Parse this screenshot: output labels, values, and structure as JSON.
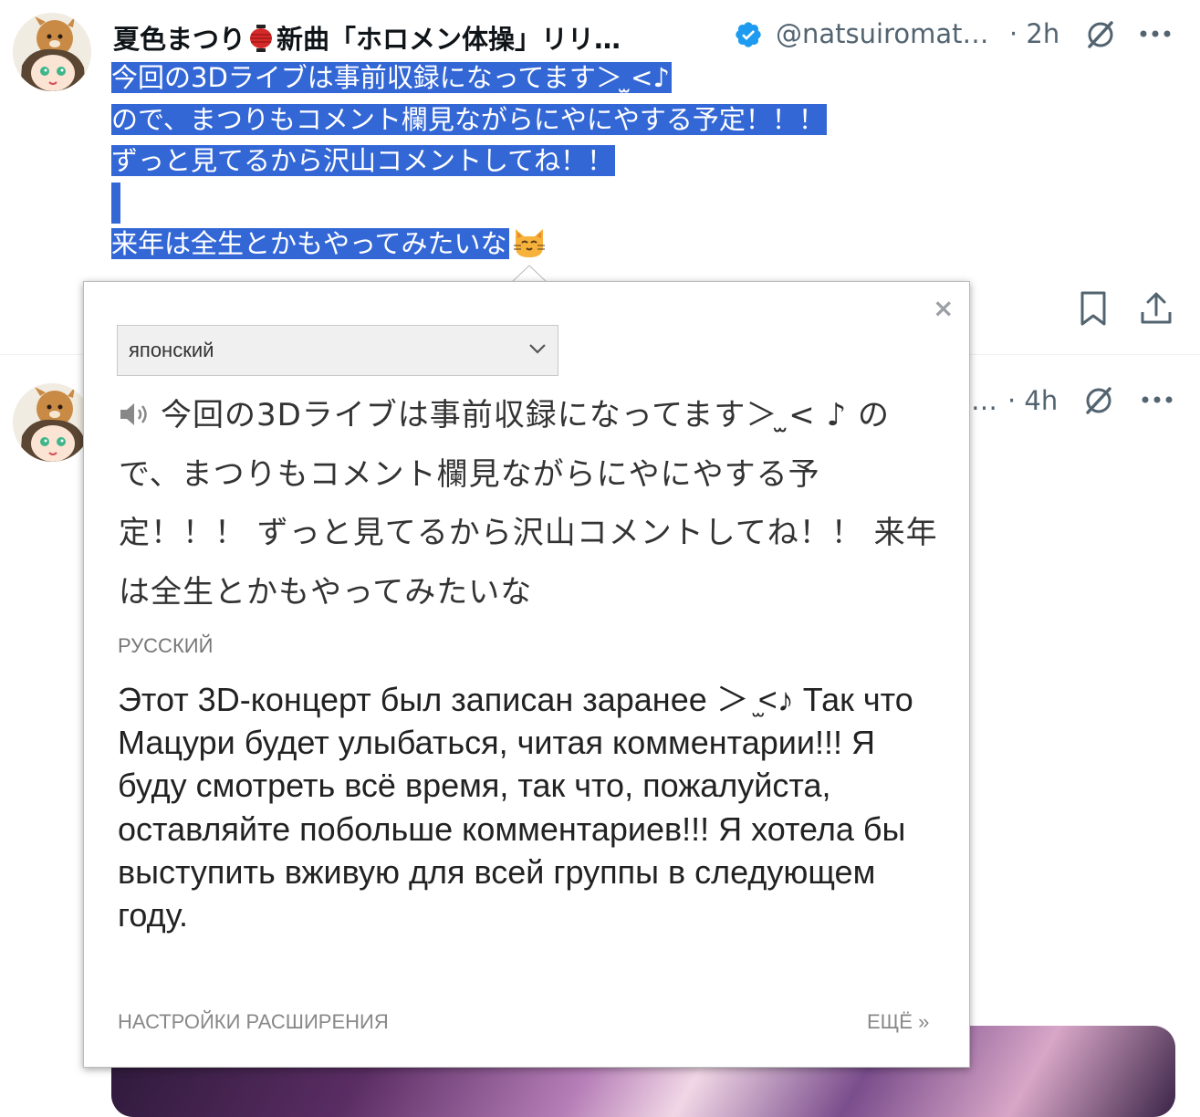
{
  "tweet1": {
    "author_name": "夏色まつり",
    "author_title": "新曲「ホロメン体操」リリ…",
    "handle": "@natsuiromat…",
    "time": "· 2h",
    "text_lines": [
      "今回の3Dライブは事前収録になってます＞ ̫<♪",
      "ので、まつりもコメント欄見ながらにやにやする予定！！！",
      "ずっと見てるから沢山コメントしてね！！",
      "",
      "来年は全生とかもやってみたいな"
    ],
    "emoji": "cat-face"
  },
  "tweet2": {
    "handle": "…",
    "time": "· 4h"
  },
  "popup": {
    "close_label": "×",
    "source_language": "японский",
    "source_text": "今回の3Dライブは事前収録になってます＞ ̫< ♪ ので、まつりもコメント欄見ながらにやにやする予定！！！ ずっと見てるから沢山コメントしてね！！ 来年は全生とかもやってみたいな",
    "target_language": "РУССКИЙ",
    "translation": "Этот 3D-концерт был записан заранее ＞ ̫<♪ Так что Мацури будет улыбаться, читая комментарии!!! Я буду смотреть всё время, так что, пожалуйста, оставляйте побольше комментариев!!! Я хотела бы выступить вживую для всей группы в следующем году.",
    "footer_settings": "НАСТРОЙКИ РАСШИРЕНИЯ",
    "footer_more": "ЕЩЁ »"
  },
  "colors": {
    "selection": "#3367d6",
    "verified": "#1d9bf0",
    "secondary_text": "#536471"
  }
}
